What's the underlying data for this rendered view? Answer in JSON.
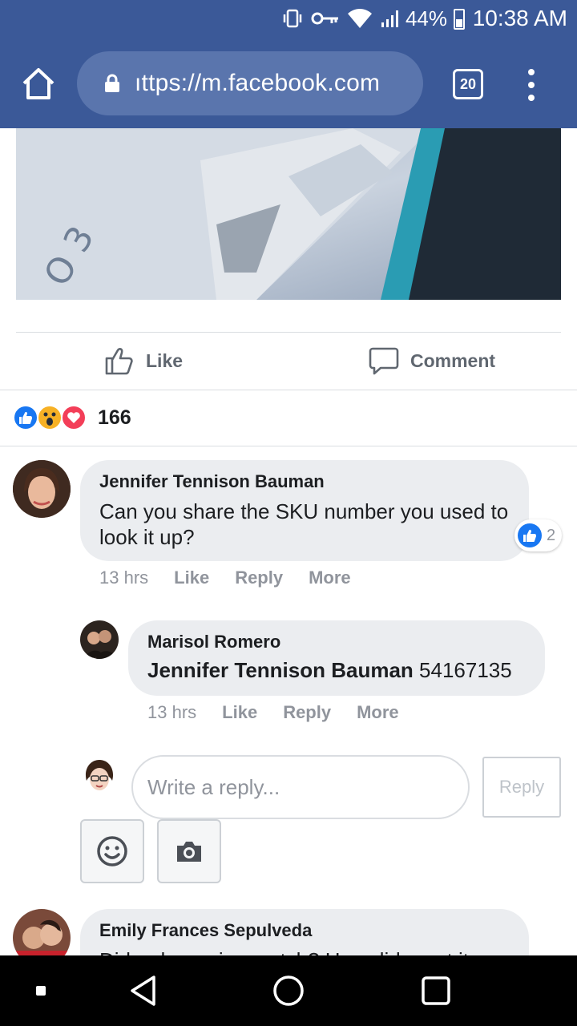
{
  "status_bar": {
    "battery": "44%",
    "time": "10:38 AM",
    "icons": [
      "vibrate-icon",
      "key-icon",
      "wifi-icon",
      "signal-icon",
      "battery-icon"
    ]
  },
  "browser": {
    "url": "ıttps://m.facebook.com",
    "tab_count": "20",
    "toolbar_color": "#3b5998",
    "url_bar_color": "#5a75ad"
  },
  "post": {
    "like_label": "Like",
    "comment_label": "Comment",
    "reaction_count": "166",
    "reactions": [
      "like",
      "wow",
      "love"
    ]
  },
  "comments": [
    {
      "author": "Jennifer Tennison Bauman",
      "text": "Can you share the SKU number you used to look it up?",
      "time": "13 hrs",
      "like_label": "Like",
      "reply_label": "Reply",
      "more_label": "More",
      "like_count": "2"
    },
    {
      "author": "Marisol Romero",
      "mention": "Jennifer Tennison Bauman",
      "text": "54167135",
      "time": "13 hrs",
      "like_label": "Like",
      "reply_label": "Reply",
      "more_label": "More"
    },
    {
      "author": "Emily Frances Sepulveda",
      "text": "Did u do a price match? How did u get it"
    }
  ],
  "composer": {
    "placeholder": "Write a reply...",
    "reply_button": "Reply"
  },
  "colors": {
    "fb_blue": "#1877f2",
    "love_red": "#f33e58",
    "wow_yellow": "#f7b125",
    "bubble": "#ebedf0",
    "muted": "#90949c"
  }
}
